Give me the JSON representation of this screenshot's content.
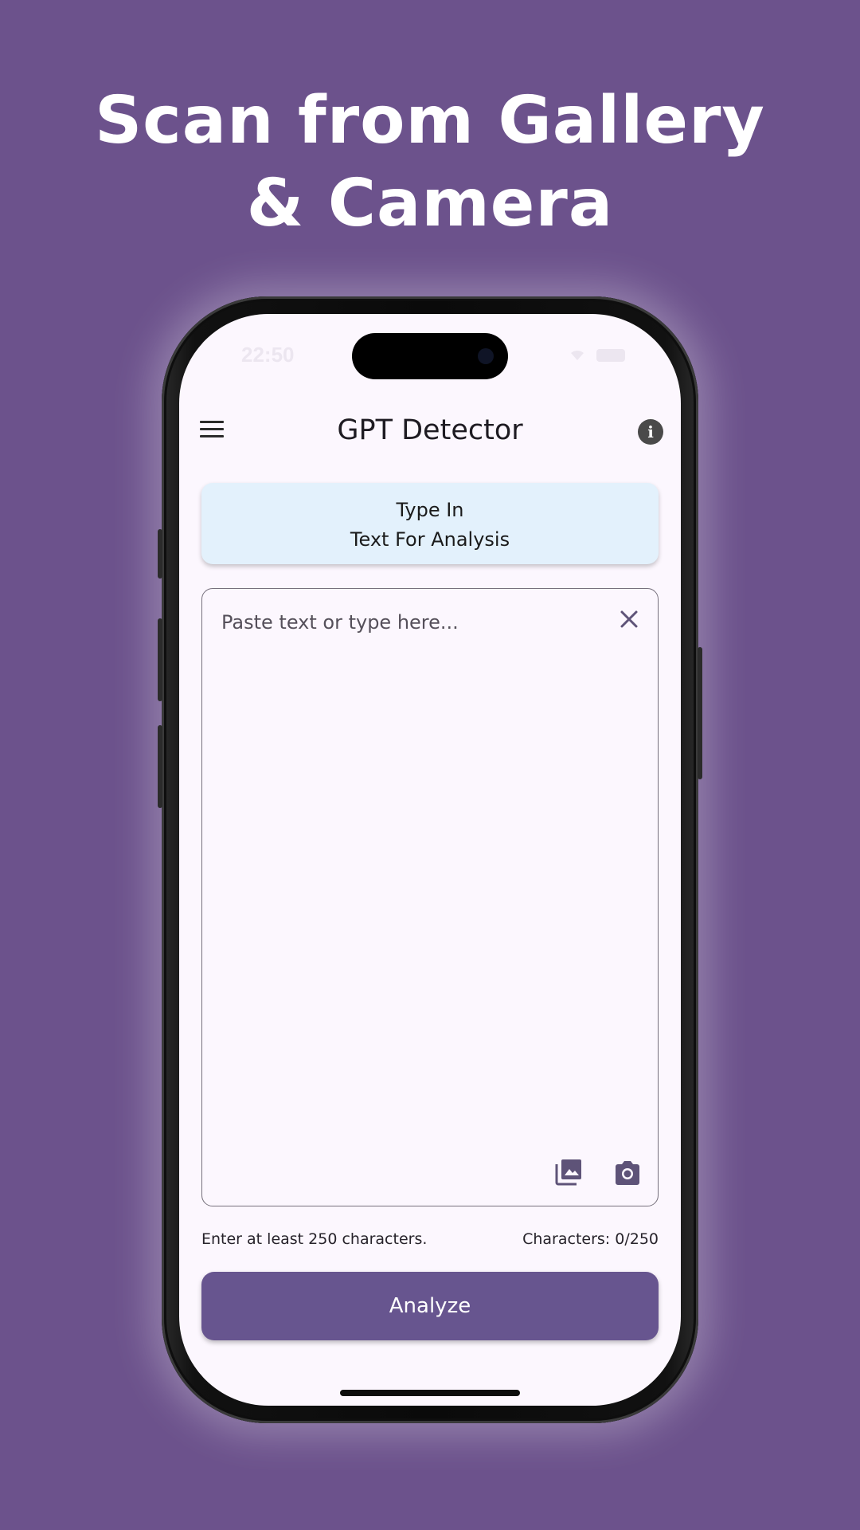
{
  "headline": {
    "line1": "Scan from Gallery",
    "line2": "& Camera"
  },
  "status_bar": {
    "time": "22:50"
  },
  "app_bar": {
    "title": "GPT Detector",
    "menu_icon": "hamburger-menu-icon",
    "info_icon": "info-icon"
  },
  "mode_card": {
    "line1": "Type In",
    "line2": "Text For Analysis"
  },
  "text_input": {
    "placeholder": "Paste text or type here...",
    "value": "",
    "clear_icon": "close-icon",
    "gallery_icon": "gallery-icon",
    "camera_icon": "camera-icon"
  },
  "footer": {
    "hint": "Enter at least 250 characters.",
    "counter": "Characters: 0/250"
  },
  "analyze_button": {
    "label": "Analyze"
  },
  "colors": {
    "background": "#6c528c",
    "accent": "#67558f",
    "card": "#e3f1fc",
    "screen": "#fcf7fe"
  }
}
